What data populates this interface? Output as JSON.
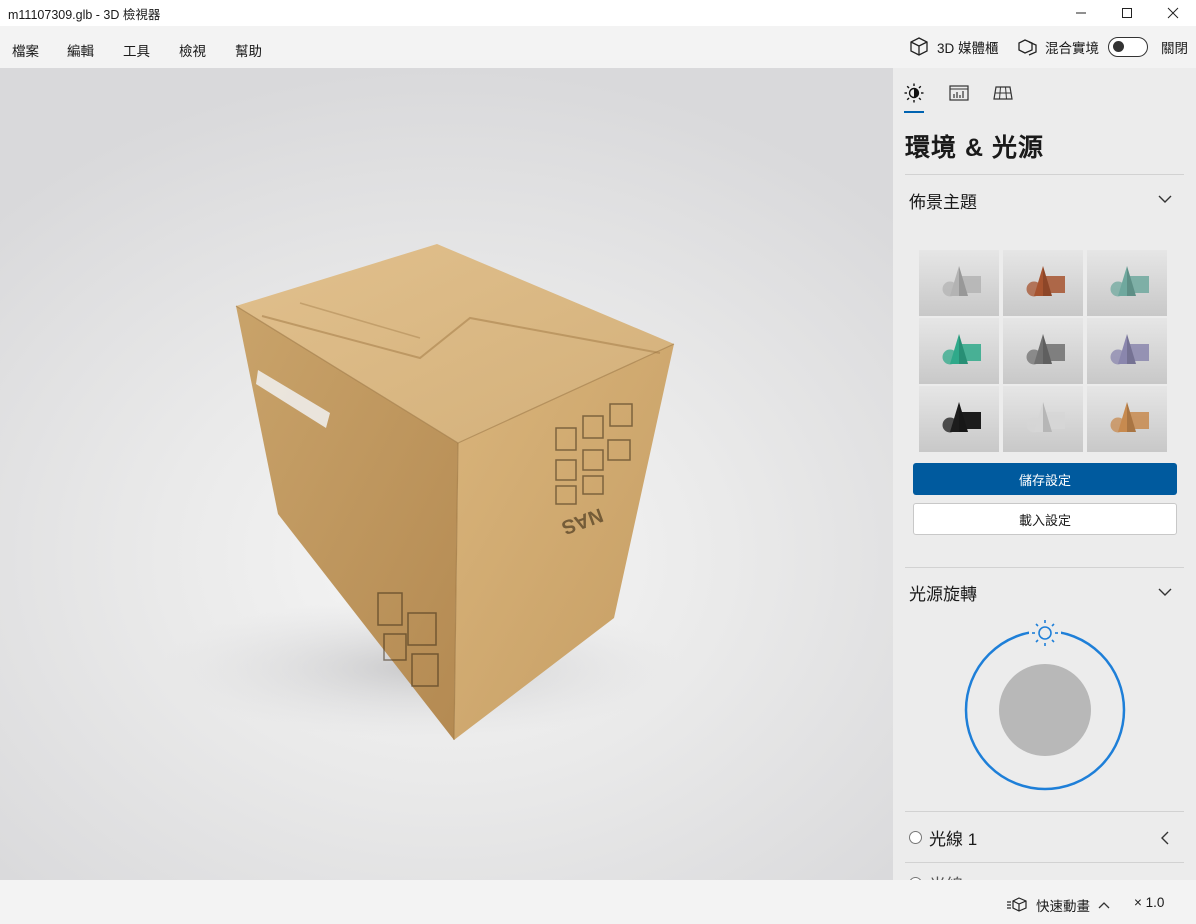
{
  "window": {
    "title": "m11107309.glb - 3D 檢視器"
  },
  "menu": {
    "items": [
      "檔案",
      "編輯",
      "工具",
      "檢視",
      "幫助"
    ],
    "library_label": "3D 媒體櫃",
    "mixed_reality_label": "混合實境",
    "toggle_state_label": "關閉"
  },
  "panel": {
    "title": "環境 & 光源",
    "tabs": [
      "environment-lighting",
      "stats",
      "grid"
    ],
    "theme_section_label": "佈景主題",
    "themes": [
      {
        "name": "neutral",
        "color": "#b3b3b3"
      },
      {
        "name": "warm-rust",
        "color": "#a6532f"
      },
      {
        "name": "teal-gray",
        "color": "#6fa89e"
      },
      {
        "name": "emerald",
        "color": "#2fa98a"
      },
      {
        "name": "dark-gray",
        "color": "#707070"
      },
      {
        "name": "lavender",
        "color": "#8a86ad"
      },
      {
        "name": "black",
        "color": "#1c1c1c"
      },
      {
        "name": "light",
        "color": "#d6d6d6"
      },
      {
        "name": "copper",
        "color": "#c78a4f"
      }
    ],
    "save_button": "儲存設定",
    "load_button": "載入設定",
    "light_rotation_label": "光源旋轉",
    "light1_label": "光線 1",
    "light2_label": "光線"
  },
  "model": {
    "print_text": "NAS"
  },
  "status": {
    "animation_label": "快速動畫",
    "zoom_label": "× 1.0"
  },
  "colors": {
    "accent": "#0063b1",
    "primary_button": "#005a9e",
    "dial_ring": "#1e7fd8"
  }
}
